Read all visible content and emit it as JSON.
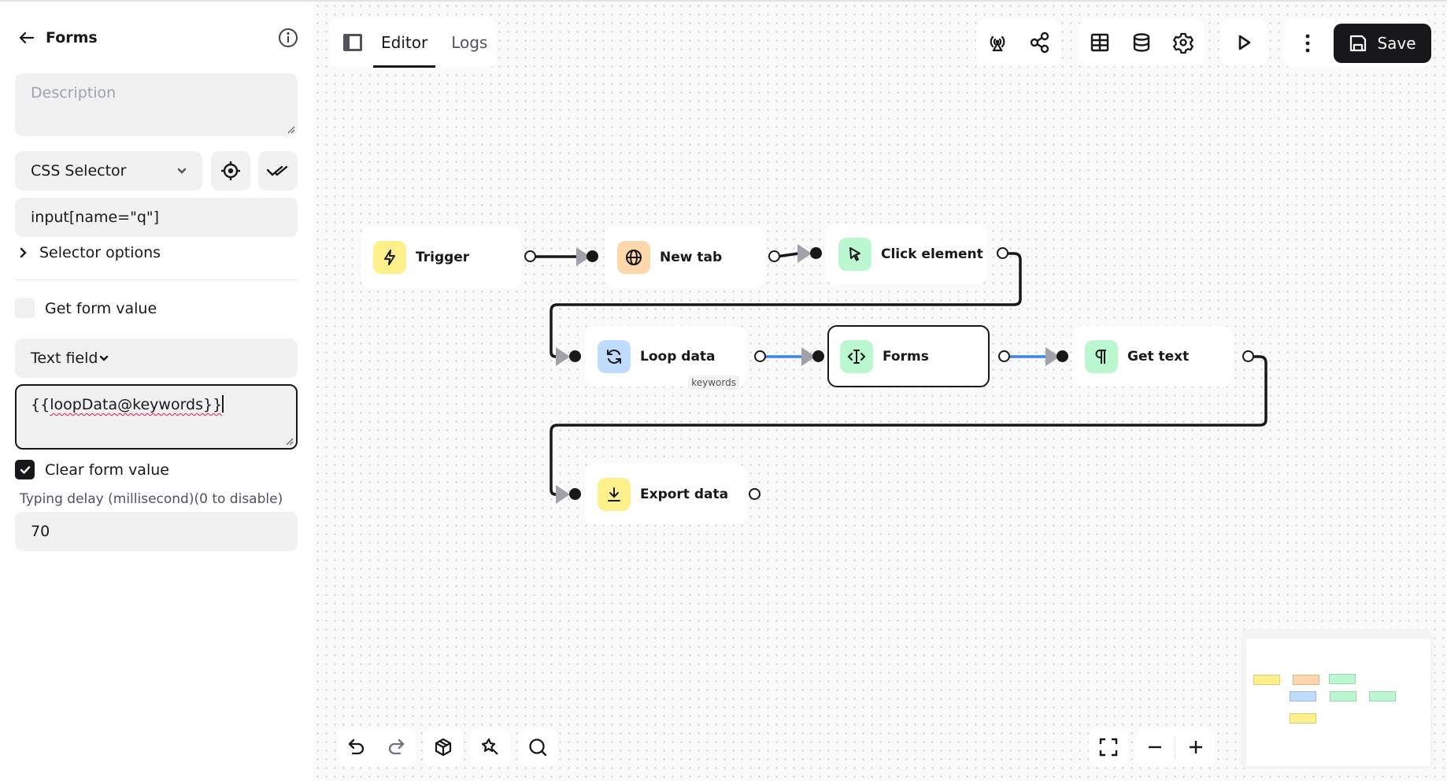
{
  "sidebar": {
    "title": "Forms",
    "description_placeholder": "Description",
    "selector_type": "CSS Selector",
    "selector_value": "input[name=\"q\"]",
    "selector_options_label": "Selector options",
    "get_form_value_label": "Get form value",
    "get_form_value_checked": false,
    "form_type": "Text field",
    "value_text": "{{loopData@keywords}}",
    "clear_form_value_label": "Clear form value",
    "clear_form_value_checked": true,
    "typing_delay_label": "Typing delay (millisecond)(0 to disable)",
    "typing_delay_value": "70"
  },
  "toolbar": {
    "tabs": [
      {
        "label": "Editor",
        "active": true
      },
      {
        "label": "Logs",
        "active": false
      }
    ],
    "save_label": "Save"
  },
  "nodes": [
    {
      "id": "trigger",
      "label": "Trigger",
      "icon": "lightning-icon",
      "color": "#fef08a"
    },
    {
      "id": "new-tab",
      "label": "New tab",
      "icon": "globe-icon",
      "color": "#fed7aa"
    },
    {
      "id": "click-element",
      "label": "Click element",
      "icon": "cursor-icon",
      "color": "#bbf7d0"
    },
    {
      "id": "loop-data",
      "label": "Loop data",
      "icon": "refresh-icon",
      "color": "#bfdbfe",
      "badge": "keywords"
    },
    {
      "id": "forms",
      "label": "Forms",
      "icon": "text-cursor-icon",
      "color": "#bbf7d0",
      "selected": true
    },
    {
      "id": "get-text",
      "label": "Get text",
      "icon": "paragraph-icon",
      "color": "#bbf7d0"
    },
    {
      "id": "export-data",
      "label": "Export data",
      "icon": "download-icon",
      "color": "#fef08a"
    }
  ],
  "edges": [
    {
      "from": "trigger",
      "to": "new-tab"
    },
    {
      "from": "new-tab",
      "to": "click-element"
    },
    {
      "from": "click-element",
      "to": "loop-data"
    },
    {
      "from": "loop-data",
      "to": "forms",
      "highlight": true
    },
    {
      "from": "forms",
      "to": "get-text",
      "highlight": true
    },
    {
      "from": "get-text",
      "to": "export-data"
    }
  ],
  "colors": {
    "accent_edge": "#3b82f6",
    "edge": "#18181b",
    "save_bg": "#18181b"
  }
}
